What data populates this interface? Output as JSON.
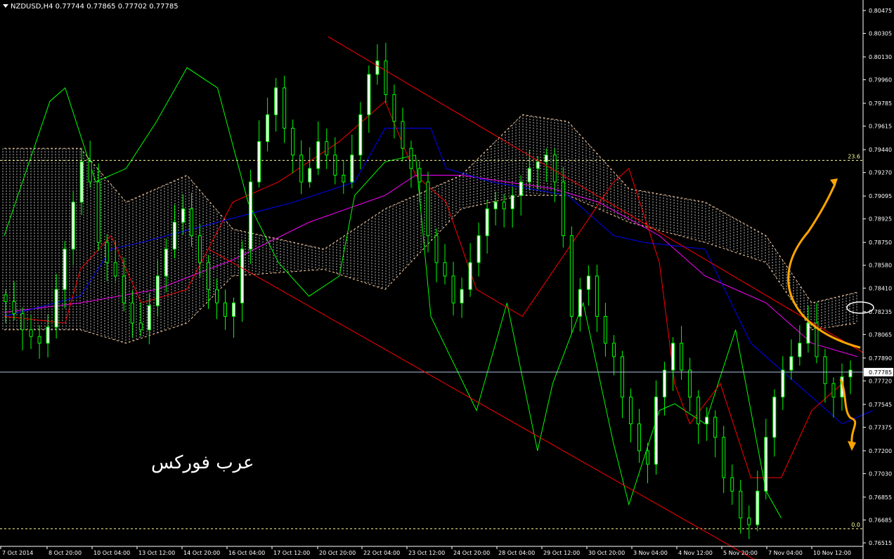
{
  "header": {
    "symbol": "NZDUSD,H4",
    "ohlc": "0.77744 0.77865 0.77702 0.77785"
  },
  "watermark": "عرب فوركس",
  "colors": {
    "background": "#000000",
    "bull_candle": "#ffffff",
    "candle_outline": "#00ff00",
    "tenkan": "#ff0000",
    "kijun": "#0000ff",
    "chikou": "#00ff00",
    "ma": "#ff00ff",
    "cloud": "#ffffff",
    "channel": "#ff0000",
    "arrows": "#ffa500",
    "grid_line": "#ffff99"
  },
  "chart_data": {
    "type": "candlestick",
    "symbol": "NZDUSD",
    "timeframe": "H4",
    "y_ticks": [
      "0.80475",
      "0.80305",
      "0.80130",
      "0.79960",
      "0.79785",
      "0.79615",
      "0.79440",
      "0.79270",
      "0.79095",
      "0.78925",
      "0.78750",
      "0.78580",
      "0.78410",
      "0.78235",
      "0.78065",
      "0.77890",
      "0.77720",
      "0.77545",
      "0.77375",
      "0.77200",
      "0.77030",
      "0.76855",
      "0.76685",
      "0.76515"
    ],
    "ylim": [
      0.76515,
      0.80475
    ],
    "x_ticks": [
      "7 Oct 2014",
      "8 Oct 20:00",
      "10 Oct 04:00",
      "13 Oct 12:00",
      "14 Oct 20:00",
      "16 Oct 04:00",
      "17 Oct 12:00",
      "20 Oct 20:00",
      "22 Oct 04:00",
      "23 Oct 12:00",
      "24 Oct 20:00",
      "28 Oct 04:00",
      "29 Oct 12:00",
      "30 Oct 20:00",
      "3 Nov 04:00",
      "4 Nov 12:00",
      "5 Nov 20:00",
      "7 Nov 04:00",
      "10 Nov 12:00"
    ],
    "current_price": "0.77785",
    "fib_levels": [
      {
        "label": "23.6",
        "price": 0.7936
      },
      {
        "label": "0.0",
        "price": 0.7662
      }
    ],
    "close_series": [
      0.7831,
      0.7822,
      0.781,
      0.7805,
      0.78,
      0.7812,
      0.784,
      0.787,
      0.7905,
      0.7935,
      0.792,
      0.7875,
      0.786,
      0.785,
      0.783,
      0.7815,
      0.781,
      0.7828,
      0.785,
      0.787,
      0.789,
      0.79,
      0.788,
      0.786,
      0.784,
      0.783,
      0.782,
      0.783,
      0.787,
      0.792,
      0.795,
      0.797,
      0.799,
      0.796,
      0.794,
      0.792,
      0.793,
      0.795,
      0.794,
      0.7925,
      0.792,
      0.794,
      0.797,
      0.8,
      0.801,
      0.7985,
      0.7965,
      0.7945,
      0.793,
      0.792,
      0.788,
      0.786,
      0.785,
      0.783,
      0.784,
      0.786,
      0.788,
      0.79,
      0.7905,
      0.79,
      0.791,
      0.792,
      0.793,
      0.7935,
      0.794,
      0.792,
      0.788,
      0.782,
      0.784,
      0.785,
      0.782,
      0.78,
      0.779,
      0.776,
      0.774,
      0.772,
      0.771,
      0.776,
      0.778,
      0.78,
      0.778,
      0.776,
      0.774,
      0.7745,
      0.773,
      0.77,
      0.769,
      0.767,
      0.7665,
      0.769,
      0.773,
      0.776,
      0.778,
      0.779,
      0.78,
      0.7815,
      0.779,
      0.777,
      0.776,
      0.7775,
      0.778
    ],
    "tenkan_pts": [
      [
        0,
        0.782
      ],
      [
        8,
        0.7815
      ],
      [
        10,
        0.7855
      ],
      [
        14,
        0.788
      ],
      [
        18,
        0.783
      ],
      [
        24,
        0.784
      ],
      [
        30,
        0.7905
      ],
      [
        36,
        0.792
      ],
      [
        44,
        0.795
      ],
      [
        50,
        0.798
      ],
      [
        54,
        0.7925
      ],
      [
        58,
        0.7905
      ],
      [
        62,
        0.784
      ],
      [
        68,
        0.782
      ],
      [
        74,
        0.787
      ],
      [
        80,
        0.792
      ],
      [
        82,
        0.793
      ],
      [
        86,
        0.786
      ],
      [
        88,
        0.777
      ],
      [
        90,
        0.774
      ],
      [
        94,
        0.777
      ],
      [
        98,
        0.77
      ],
      [
        102,
        0.77
      ],
      [
        106,
        0.775
      ],
      [
        110,
        0.777
      ]
    ],
    "kijun_pts": [
      [
        0,
        0.782
      ],
      [
        10,
        0.7835
      ],
      [
        14,
        0.787
      ],
      [
        18,
        0.7875
      ],
      [
        28,
        0.789
      ],
      [
        38,
        0.7905
      ],
      [
        46,
        0.792
      ],
      [
        50,
        0.796
      ],
      [
        56,
        0.796
      ],
      [
        58,
        0.793
      ],
      [
        64,
        0.792
      ],
      [
        74,
        0.791
      ],
      [
        80,
        0.788
      ],
      [
        84,
        0.7875
      ],
      [
        92,
        0.787
      ],
      [
        98,
        0.78
      ],
      [
        104,
        0.777
      ],
      [
        110,
        0.774
      ],
      [
        114,
        0.775
      ]
    ],
    "ma_pts": [
      [
        0,
        0.7823
      ],
      [
        10,
        0.783
      ],
      [
        20,
        0.784
      ],
      [
        30,
        0.7862
      ],
      [
        40,
        0.789
      ],
      [
        50,
        0.791
      ],
      [
        54,
        0.7925
      ],
      [
        60,
        0.7925
      ],
      [
        66,
        0.792
      ],
      [
        72,
        0.7915
      ],
      [
        78,
        0.7905
      ],
      [
        86,
        0.788
      ],
      [
        92,
        0.785
      ],
      [
        100,
        0.783
      ],
      [
        106,
        0.78
      ],
      [
        112,
        0.779
      ]
    ],
    "cloud_top": [
      [
        0,
        0.7945
      ],
      [
        10,
        0.7945
      ],
      [
        16,
        0.7905
      ],
      [
        24,
        0.7925
      ],
      [
        30,
        0.7885
      ],
      [
        42,
        0.787
      ],
      [
        50,
        0.79
      ],
      [
        60,
        0.7925
      ],
      [
        68,
        0.797
      ],
      [
        74,
        0.7965
      ],
      [
        82,
        0.7915
      ],
      [
        92,
        0.7905
      ],
      [
        100,
        0.788
      ],
      [
        106,
        0.783
      ],
      [
        112,
        0.7838
      ]
    ],
    "cloud_bottom": [
      [
        0,
        0.781
      ],
      [
        10,
        0.781
      ],
      [
        16,
        0.78
      ],
      [
        24,
        0.7815
      ],
      [
        30,
        0.785
      ],
      [
        42,
        0.7855
      ],
      [
        50,
        0.784
      ],
      [
        60,
        0.79
      ],
      [
        68,
        0.791
      ],
      [
        74,
        0.791
      ],
      [
        82,
        0.789
      ],
      [
        92,
        0.7875
      ],
      [
        100,
        0.786
      ],
      [
        106,
        0.781
      ],
      [
        112,
        0.7815
      ]
    ],
    "chikou_pts": [
      [
        0,
        0.788
      ],
      [
        6,
        0.798
      ],
      [
        8,
        0.799
      ],
      [
        12,
        0.792
      ],
      [
        16,
        0.793
      ],
      [
        20,
        0.7965
      ],
      [
        24,
        0.8005
      ],
      [
        28,
        0.799
      ],
      [
        32,
        0.7905
      ],
      [
        36,
        0.786
      ],
      [
        40,
        0.7835
      ],
      [
        44,
        0.785
      ],
      [
        46,
        0.791
      ],
      [
        50,
        0.7935
      ],
      [
        54,
        0.794
      ],
      [
        56,
        0.782
      ],
      [
        62,
        0.775
      ],
      [
        66,
        0.783
      ],
      [
        70,
        0.772
      ],
      [
        72,
        0.777
      ],
      [
        76,
        0.783
      ],
      [
        80,
        0.7725
      ],
      [
        82,
        0.768
      ],
      [
        86,
        0.775
      ],
      [
        88,
        0.7755
      ],
      [
        92,
        0.774
      ],
      [
        96,
        0.781
      ],
      [
        100,
        0.769
      ],
      [
        102,
        0.767
      ]
    ],
    "channel_upper": [
      [
        0.0,
        0.8028
      ],
      [
        1.0,
        0.7793
      ]
    ],
    "channel_lower": [
      [
        0.0,
        0.787
      ],
      [
        1.0,
        0.7633
      ]
    ],
    "arrows": [
      "up",
      "down"
    ]
  }
}
